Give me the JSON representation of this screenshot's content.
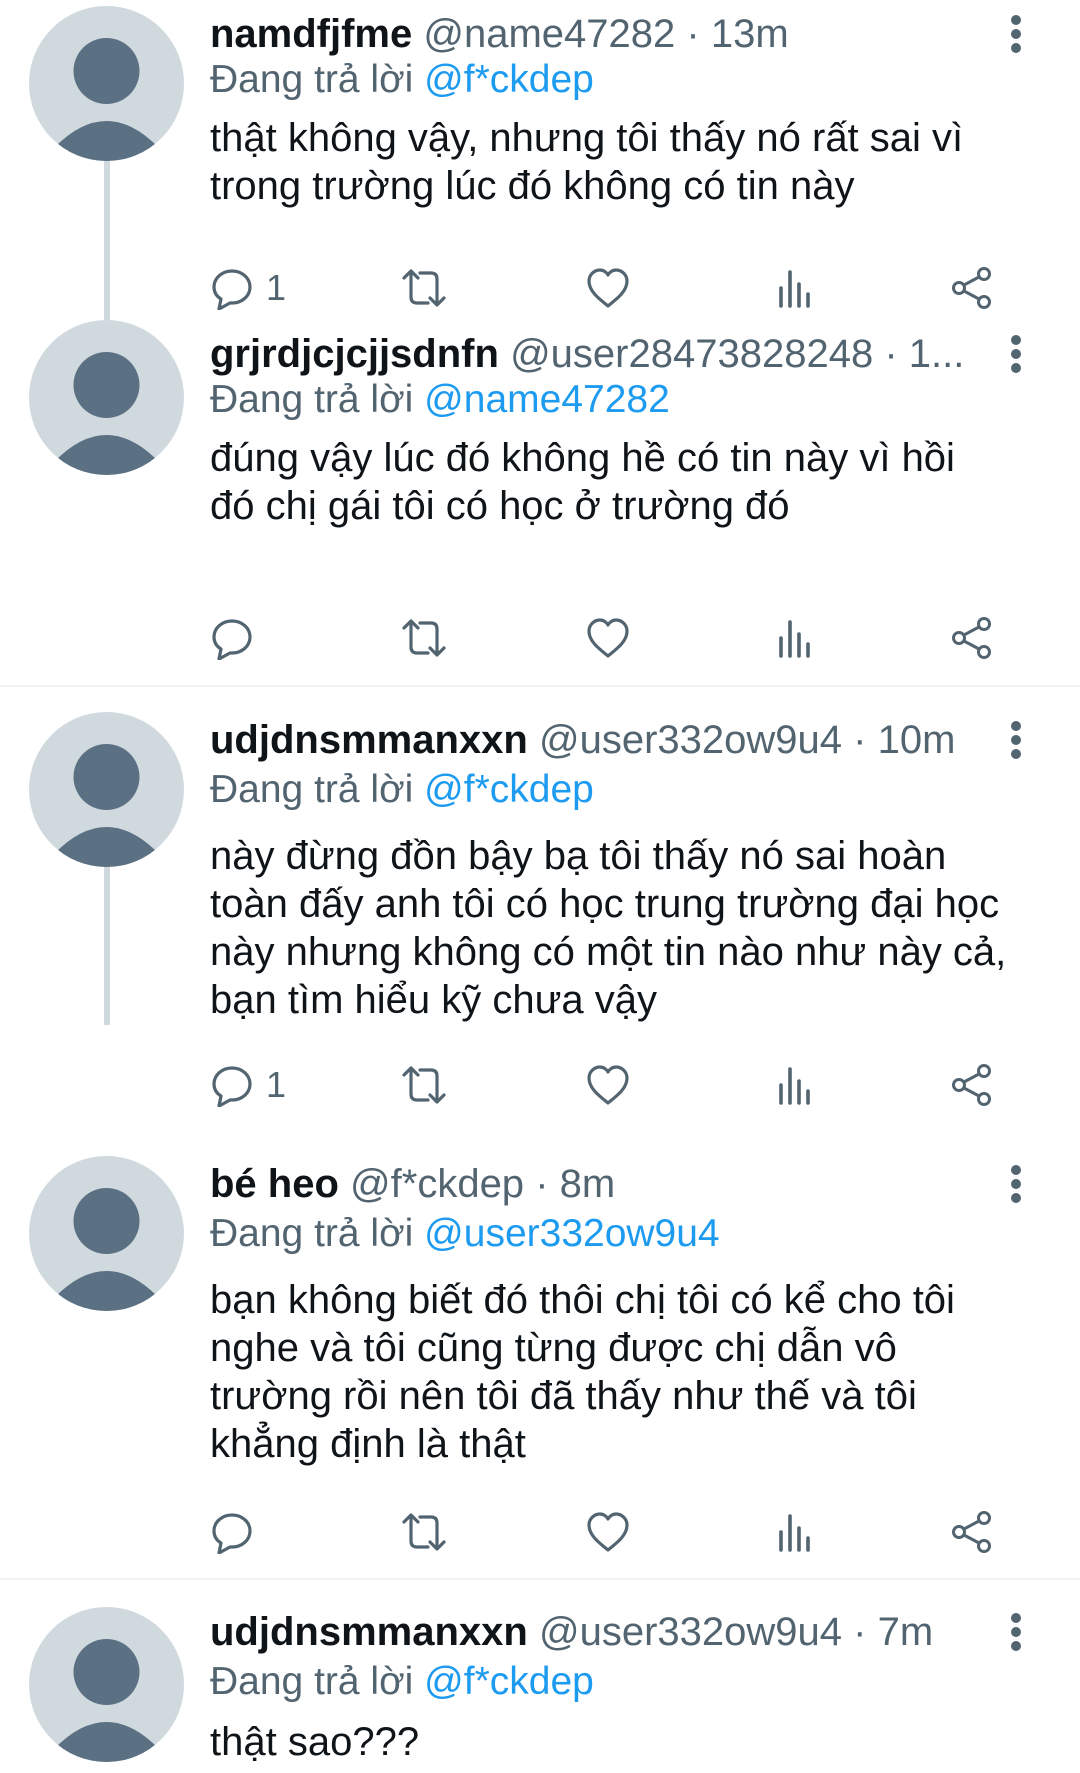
{
  "tweets": [
    {
      "name": "namdfjfme",
      "handle": "@name47282",
      "separator": "·",
      "time": "13m",
      "reply_prefix": "Đang trả lời",
      "reply_to": "@f*ckdep",
      "text_lines": [
        "thật không vậy, nhưng tôi thấy nó rất sai vì",
        "trong trường lúc đó không có tin này"
      ],
      "reply_count": "1"
    },
    {
      "name": "grjrdjcjcjjsdnfn",
      "handle": "@user28473828248",
      "separator": "·",
      "time": "1...",
      "reply_prefix": "Đang trả lời",
      "reply_to": "@name47282",
      "text_lines": [
        "đúng vậy lúc đó không hề có tin này vì hồi",
        "đó chị gái tôi có học ở trường đó"
      ],
      "reply_count": ""
    },
    {
      "name": "udjdnsmmanxxn",
      "handle": "@user332ow9u4",
      "separator": "·",
      "time": "10m",
      "reply_prefix": "Đang trả lời",
      "reply_to": "@f*ckdep",
      "text_lines": [
        "này đừng đồn bậy bạ tôi thấy nó sai hoàn",
        "toàn đấy anh tôi có học trung trường đại học",
        "này nhưng không có một tin nào như này cả,",
        "bạn tìm hiểu kỹ chưa vậy"
      ],
      "reply_count": "1"
    },
    {
      "name": "bé heo",
      "handle": "@f*ckdep",
      "separator": "·",
      "time": "8m",
      "reply_prefix": "Đang trả lời",
      "reply_to": "@user332ow9u4",
      "text_lines": [
        "bạn không biết đó thôi chị tôi có kể cho tôi",
        "nghe và tôi cũng từng được chị dẫn vô",
        "trường rồi nên tôi đã thấy như thế và tôi",
        "khẳng định là thật"
      ],
      "reply_count": ""
    },
    {
      "name": "udjdnsmmanxxn",
      "handle": "@user332ow9u4",
      "separator": "·",
      "time": "7m",
      "reply_prefix": "Đang trả lời",
      "reply_to": "@f*ckdep",
      "text_lines": [
        "thật sao???"
      ],
      "reply_count": ""
    }
  ],
  "icons": {
    "reply": "reply-icon",
    "retweet": "retweet-icon",
    "like": "like-icon",
    "analytics": "analytics-icon",
    "share": "share-icon",
    "menu": "more-icon",
    "avatar": "default-avatar-icon"
  },
  "colors": {
    "accent": "#1d9bf0",
    "secondary_text": "#536471",
    "primary_text": "#0f1419",
    "avatar_bg": "#cfd9de",
    "avatar_fg": "#5b7083",
    "icon": "#536471",
    "divider": "#eff3f4"
  }
}
